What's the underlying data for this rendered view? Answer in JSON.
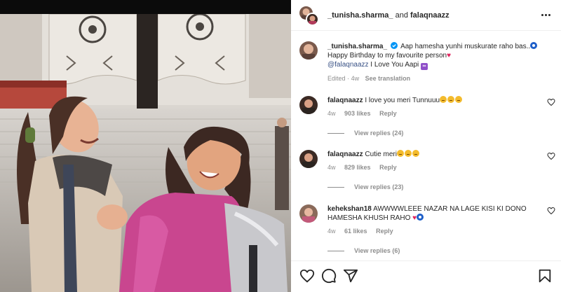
{
  "header": {
    "user1": "_tunisha.sharma_",
    "conj": " and ",
    "user2": "falaqnaazz"
  },
  "caption": {
    "username": "_tunisha.sharma_",
    "line1": "Aap hamesha yunhi muskurate raho bas..",
    "line2": "Happy Birthday to my favourite person",
    "mention": "@falaqnaazz",
    "line3": " I Love You Aapi",
    "emoji_infinity": "∞",
    "edited": "Edited",
    "time": "4w",
    "see_translation": "See translation"
  },
  "comments": [
    {
      "username": "falaqnaazz",
      "text": "I love you meri Tunnuuu",
      "time": "4w",
      "likes": "903 likes",
      "reply": "Reply",
      "view_replies": "View replies (24)"
    },
    {
      "username": "falaqnaazz",
      "text": "Cutie meri",
      "time": "4w",
      "likes": "829 likes",
      "reply": "Reply",
      "view_replies": "View replies (23)"
    },
    {
      "username": "kehekshan18",
      "text": "AWWWWLEEE NAZAR NA LAGE KISI KI DONO HAMESHA KHUSH RAHO",
      "time": "4w",
      "likes": "61 likes",
      "reply": "Reply",
      "view_replies": "View replies (6)"
    }
  ],
  "icons": {
    "more": "more-options-icon",
    "like": "heart-icon",
    "comment": "comment-bubble-icon",
    "share": "share-plane-icon",
    "save": "bookmark-icon",
    "verified": "verified-badge-icon"
  },
  "colors": {
    "link": "#385185",
    "muted": "#8e8e8e",
    "text": "#262626",
    "verified": "#0095f6"
  }
}
